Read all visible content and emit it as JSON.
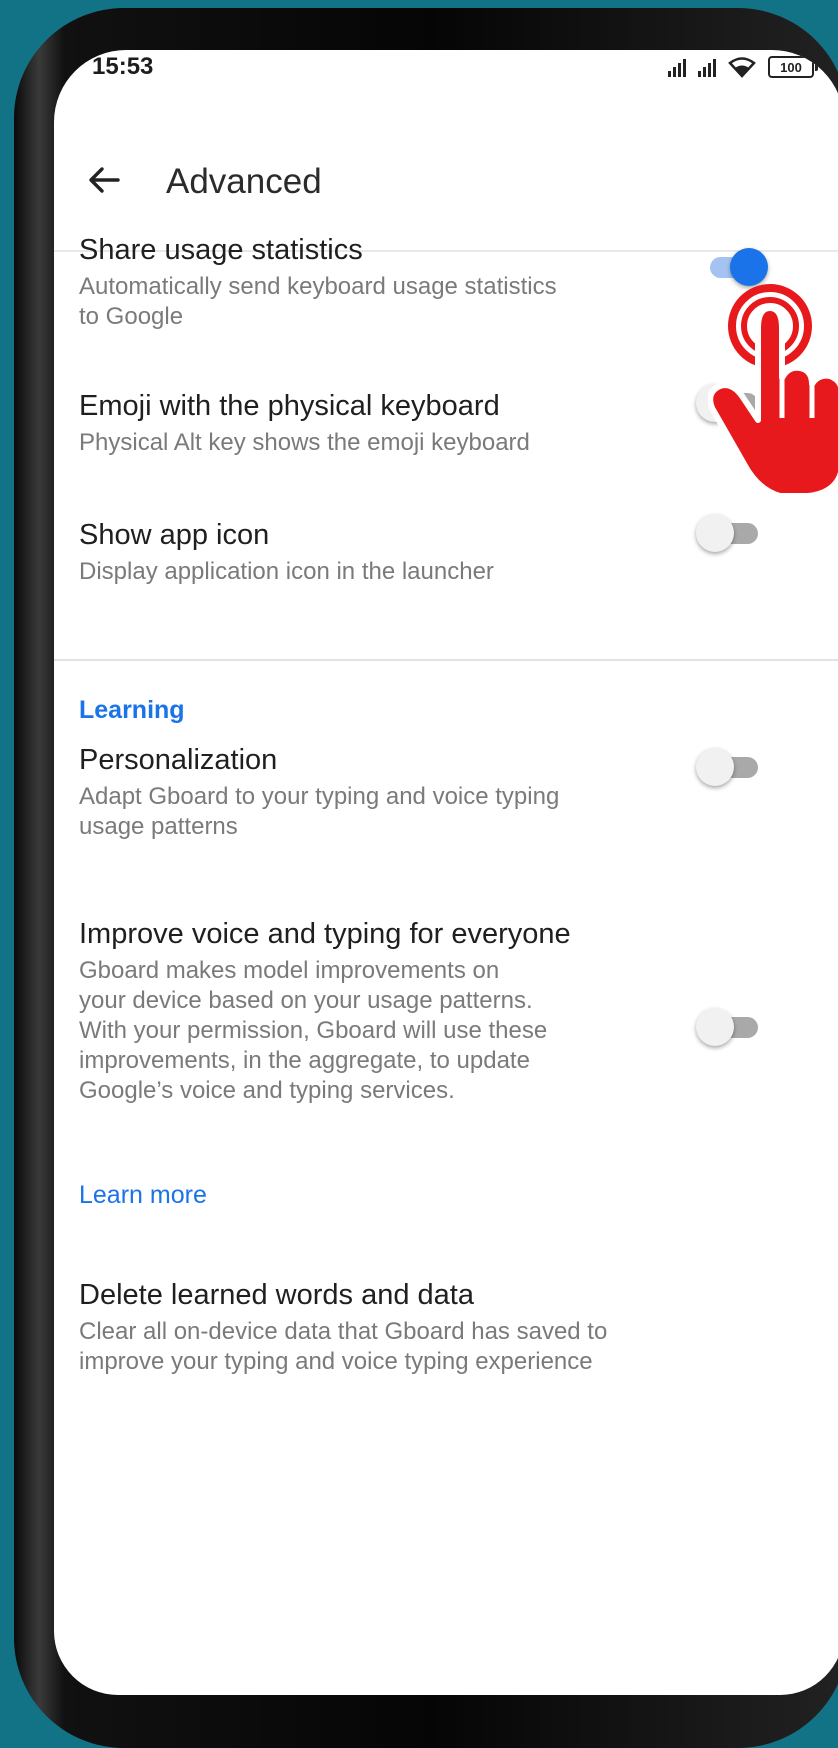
{
  "status_bar": {
    "time": "15:53",
    "battery": "100",
    "icons": [
      "signal-icon",
      "signal-icon",
      "wifi-icon",
      "battery-icon"
    ]
  },
  "app_bar": {
    "title": "Advanced",
    "back_icon": "arrow-left-icon"
  },
  "settings": [
    {
      "title": "Share usage statistics",
      "subtitle_lines": [
        "Automatically send keyboard usage statistics",
        "to Google"
      ],
      "enabled": true
    },
    {
      "title": "Emoji with the physical keyboard",
      "subtitle_lines": [
        "Physical Alt key shows the emoji keyboard"
      ],
      "enabled": false
    },
    {
      "title": "Show app icon",
      "subtitle_lines": [
        "Display application icon in the launcher"
      ],
      "enabled": false
    }
  ],
  "learning": {
    "header": "Learning",
    "items": [
      {
        "title": "Personalization",
        "subtitle_lines": [
          "Adapt Gboard to your typing and voice typing",
          "usage patterns"
        ],
        "enabled": false
      },
      {
        "title": "Improve voice and typing for everyone",
        "subtitle_lines": [
          "Gboard makes model improvements on",
          "your device based on your usage patterns.",
          "With your permission, Gboard will use these",
          "improvements, in the aggregate, to update",
          "Google’s voice and typing services."
        ],
        "enabled": false
      }
    ],
    "learn_more": "Learn more",
    "delete": {
      "title": "Delete learned words and data",
      "subtitle_lines": [
        "Clear all on-device data that Gboard has saved to",
        "improve your typing and voice typing experience"
      ]
    }
  },
  "colors": {
    "accent": "#1a73e8",
    "background": "#127386",
    "pointer": "#e8191c"
  },
  "overlay": {
    "icon": "tap-hand-icon"
  }
}
